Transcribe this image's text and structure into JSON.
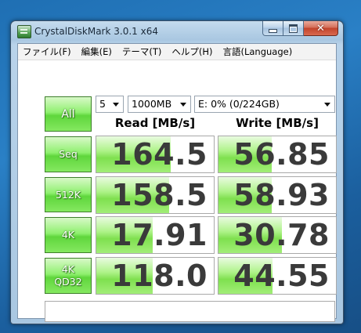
{
  "window": {
    "title": "CrystalDiskMark 3.0.1 x64",
    "close_glyph": "✕"
  },
  "menu": [
    "ファイル(F)",
    "編集(E)",
    "テーマ(T)",
    "ヘルプ(H)",
    "言語(Language)"
  ],
  "controls": {
    "all_label": "All",
    "count": "5",
    "size": "1000MB",
    "drive": "E: 0% (0/224GB)"
  },
  "headers": {
    "read": "Read [MB/s]",
    "write": "Write [MB/s]"
  },
  "rows": [
    {
      "label": [
        "Seq"
      ],
      "read": "164.5",
      "write": "56.85",
      "read_fill": 0.63,
      "write_fill": 0.45
    },
    {
      "label": [
        "512K"
      ],
      "read": "158.5",
      "write": "58.93",
      "read_fill": 0.62,
      "write_fill": 0.45
    },
    {
      "label": [
        "4K"
      ],
      "read": "17.91",
      "write": "30.78",
      "read_fill": 0.48,
      "write_fill": 0.54
    },
    {
      "label": [
        "4K",
        "QD32"
      ],
      "read": "118.0",
      "write": "44.55",
      "read_fill": 0.48,
      "write_fill": 0.46
    }
  ],
  "comment": ""
}
